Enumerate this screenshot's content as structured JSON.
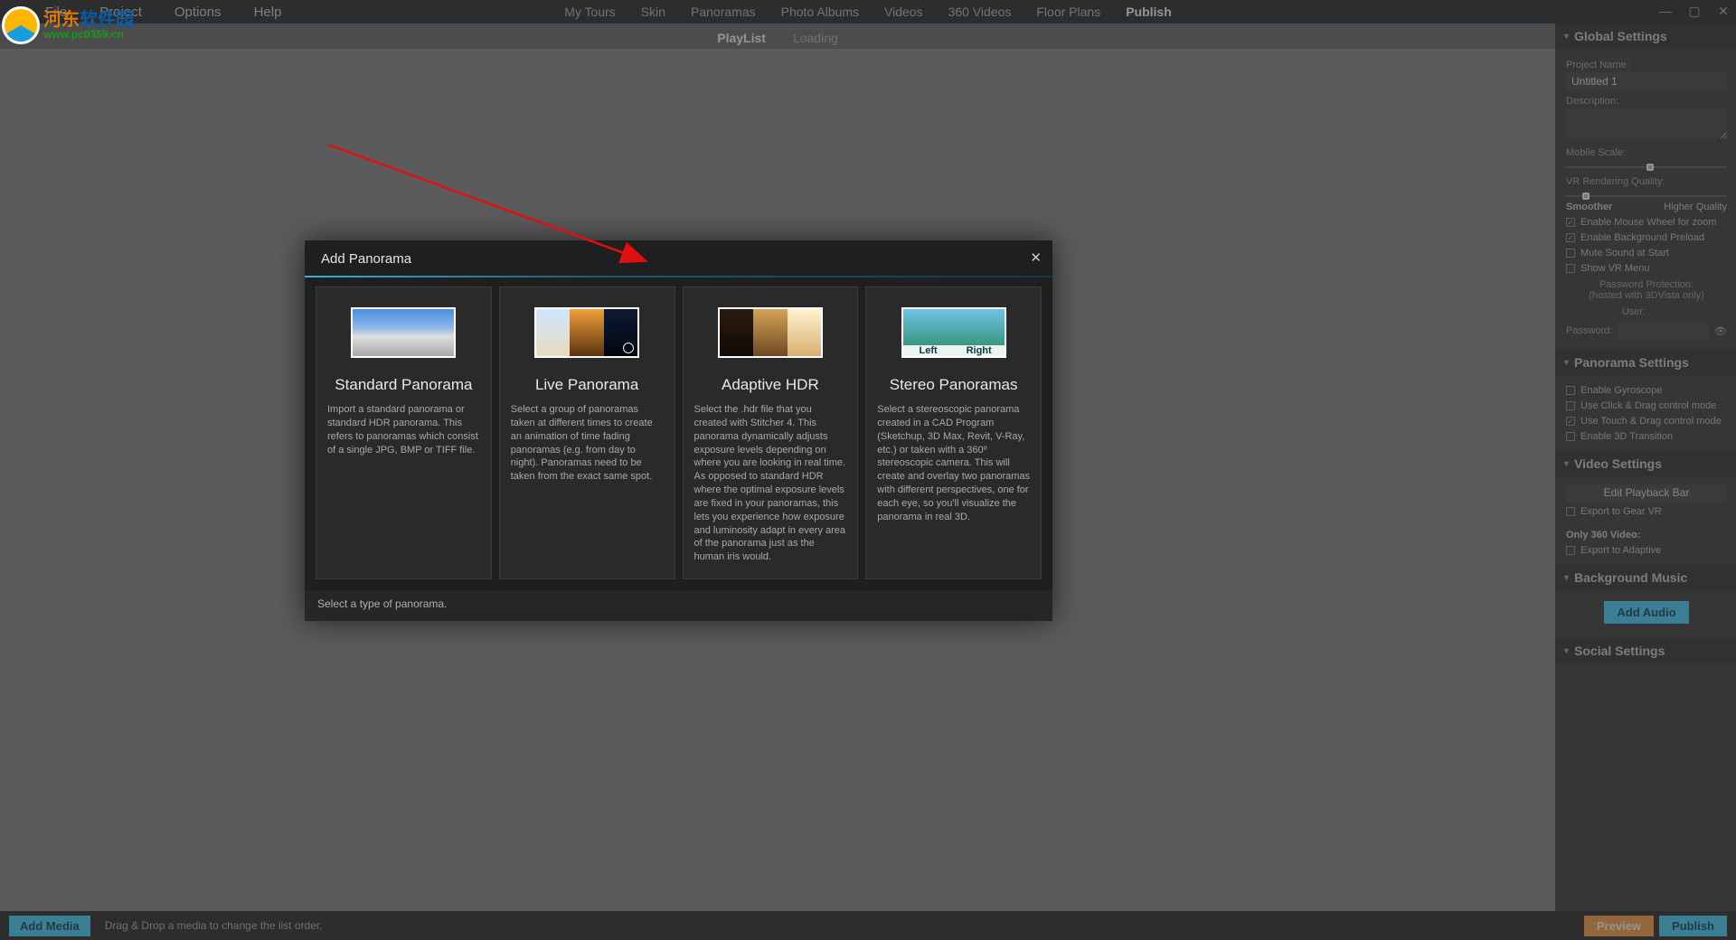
{
  "menu": {
    "file": "File",
    "project": "Project",
    "options": "Options",
    "help": "Help"
  },
  "topnav": {
    "items": [
      "My Tours",
      "Skin",
      "Panoramas",
      "Photo Albums",
      "Videos",
      "360 Videos",
      "Floor Plans",
      "Publish"
    ],
    "active": "Publish"
  },
  "subnav": {
    "playlist": "PlayList",
    "loading": "Loading",
    "active": "PlayList"
  },
  "right": {
    "global": {
      "title": "Global Settings",
      "project_name_label": "Project Name:",
      "project_name_value": "Untitled 1",
      "description_label": "Description:",
      "mobile_scale_label": "Mobile Scale:",
      "vr_quality_label": "VR Rendering Quality:",
      "smoother": "Smoother",
      "higher": "Higher Quality",
      "chk_mouse": "Enable Mouse Wheel for zoom",
      "chk_preload": "Enable Background Preload",
      "chk_mute": "Mute Sound at Start",
      "chk_vrmenu": "Show VR Menu",
      "pwd_label1": "Password Protection:",
      "pwd_label2": "(hosted with 3DVista only)",
      "user_label": "User:",
      "password_label": "Password:"
    },
    "pano": {
      "title": "Panorama Settings",
      "chk_gyro": "Enable Gyroscope",
      "chk_click": "Use Click & Drag control mode",
      "chk_touch": "Use Touch & Drag control mode",
      "chk_3d": "Enable 3D Transition"
    },
    "video": {
      "title": "Video Settings",
      "edit_pb": "Edit Playback Bar",
      "chk_gear": "Export to Gear VR",
      "only360": "Only 360 Video:",
      "chk_adaptive": "Export to Adaptive"
    },
    "music": {
      "title": "Background Music",
      "add_audio": "Add Audio"
    },
    "social": {
      "title": "Social Settings"
    }
  },
  "bottom": {
    "add_media": "Add Media",
    "hint": "Drag & Drop a media to change the list order.",
    "preview": "Preview",
    "publish": "Publish"
  },
  "modal": {
    "title": "Add Panorama",
    "footer": "Select a type of panorama.",
    "cards": [
      {
        "title": "Standard Panorama",
        "desc": "Import a standard panorama or standard HDR panorama. This refers to panoramas which consist of a single JPG, BMP or TIFF file."
      },
      {
        "title": "Live Panorama",
        "desc": "Select a group of panoramas taken at different times to create an animation of time fading panoramas (e.g. from day to night). Panoramas need to be taken from the exact same spot."
      },
      {
        "title": "Adaptive HDR",
        "desc": "Select the .hdr file that you created with Stitcher 4. This panorama dynamically adjusts exposure levels depending on where you are looking in real time. As opposed to standard HDR where the optimal exposure levels are fixed in your panoramas, this lets you experience how exposure and luminosity adapt in every area of the panorama just as the human iris would."
      },
      {
        "title": "Stereo Panoramas",
        "desc": "Select a stereoscopic panorama created in a CAD Program (Sketchup, 3D Max, Revit, V-Ray, etc.) or taken with a 360º stereoscopic camera. This will create and overlay two panoramas with different perspectives, one for each eye, so you'll visualize the panorama in real 3D."
      }
    ],
    "stereo_left": "Left",
    "stereo_right": "Right"
  },
  "logo": {
    "cn_a": "河东",
    "cn_b": "软件园",
    "url": "www.pc0359.cn"
  }
}
